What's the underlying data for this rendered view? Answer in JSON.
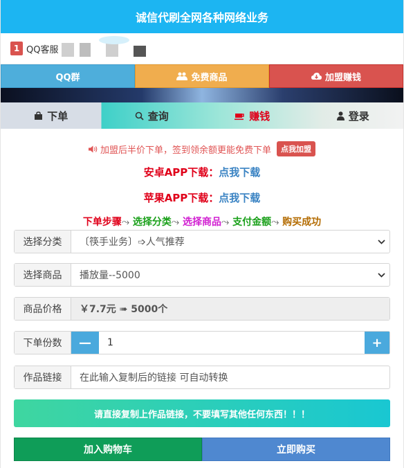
{
  "header": {
    "title": "诚信代刷全网各种网络业务"
  },
  "service": {
    "number": "1",
    "label": "QQ客服"
  },
  "top_buttons": {
    "qq_group": "QQ群",
    "free_goods": "免费商品",
    "join_earn": "加盟赚钱"
  },
  "tabs": {
    "order": "下单",
    "query": "查询",
    "earn": "赚钱",
    "login": "登录"
  },
  "notice": {
    "text": "加盟后半价下单，签到领余额更能免费下单",
    "button": "点我加盟"
  },
  "downloads": {
    "android_key": "安卓APP下载：",
    "android_val": "点我下载",
    "apple_key": "苹果APP下载：",
    "apple_val": "点我下载"
  },
  "steps": {
    "s1": "下单步骤",
    "s2": "选择分类",
    "s3": "选择商品",
    "s4": "支付金额",
    "s5": "购买成功",
    "arrow": "⤳"
  },
  "form": {
    "category_label": "选择分类",
    "category_value": "〔筷手业务〕➩人气推荐",
    "product_label": "选择商品",
    "product_value": "播放量--5000",
    "price_label": "商品价格",
    "price_value": "￥7.7元 ➠ 5000个",
    "qty_label": "下单份数",
    "qty_value": "1",
    "minus": "—",
    "plus": "+",
    "link_label": "作品链接",
    "link_placeholder": "在此输入复制后的链接 可自动转换"
  },
  "warning": "请直接复制上作品链接，不要填写其他任何东西！！！",
  "actions": {
    "cart": "加入购物车",
    "buy": "立即购买"
  },
  "colors": {
    "header": "#1cb5f2",
    "red": "#d9534f",
    "orange": "#f0ad4e",
    "blue": "#4eaedb",
    "green": "#0f9d58"
  }
}
